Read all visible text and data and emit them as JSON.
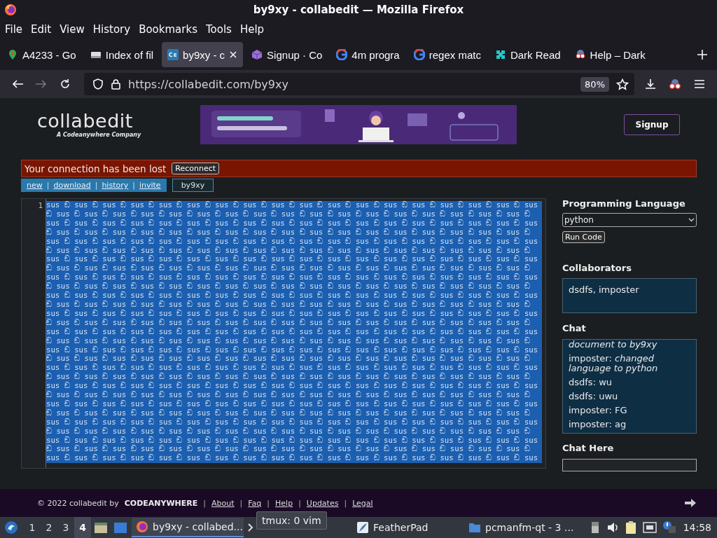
{
  "window": {
    "title": "by9xy - collabedit — Mozilla Firefox"
  },
  "menu": [
    "File",
    "Edit",
    "View",
    "History",
    "Bookmarks",
    "Tools",
    "Help"
  ],
  "tabs": [
    {
      "label": "A4233 - Go",
      "selected": false,
      "kind": "pin"
    },
    {
      "label": "Index of fil",
      "selected": false,
      "kind": "drive"
    },
    {
      "label": "by9xy - c",
      "selected": true,
      "kind": "ce"
    },
    {
      "label": "Signup · Co",
      "selected": false,
      "kind": "cube"
    },
    {
      "label": "4m progra",
      "selected": false,
      "kind": "g"
    },
    {
      "label": "regex matc",
      "selected": false,
      "kind": "g"
    },
    {
      "label": "Dark Read",
      "selected": false,
      "kind": "puzzle"
    },
    {
      "label": "Help – Dark",
      "selected": false,
      "kind": "mask"
    }
  ],
  "navbar": {
    "url": "https://collabedit.com/by9xy",
    "zoom": "80%"
  },
  "header": {
    "logo": "collabedit",
    "tagline": "A Codeanywhere Company",
    "signup": "Signup"
  },
  "alert": {
    "message": "Your connection has been lost",
    "button": "Reconnect"
  },
  "doc_links": [
    {
      "kind": "link",
      "text": "new"
    },
    {
      "kind": "separator",
      "text": "|"
    },
    {
      "kind": "link",
      "text": "download"
    },
    {
      "kind": "separator",
      "text": "|"
    },
    {
      "kind": "link",
      "text": "history"
    },
    {
      "kind": "separator",
      "text": "|"
    },
    {
      "kind": "link",
      "text": "invite"
    }
  ],
  "doc_tab": "by9xy",
  "editor": {
    "line_number": "1",
    "selected": true,
    "rows": [
      "sus ඞ sus ඞ sus ඞ sus ඞ sus ඞ sus ඞ sus ඞ sus ඞ sus ඞ sus ඞ sus ඞ sus ඞ sus ඞ sus ඞ sus ඞ sus ඞ sus ඞ sus",
      "ඞ sus ඞ sus ඞ sus ඞ sus ඞ sus ඞ sus ඞ sus ඞ sus ඞ sus ඞ sus ඞ sus ඞ sus ඞ sus ඞ sus ඞ sus ඞ sus ඞ sus ඞ",
      "sus ඞ sus ඞ sus ඞ sus ඞ sus ඞ sus ඞ sus ඞ sus ඞ sus ඞ sus ඞ sus ඞ sus ඞ sus ඞ sus ඞ sus ඞ sus ඞ sus ඞ sus",
      "ඞ sus ඞ sus ඞ sus ඞ sus ඞ sus ඞ sus ඞ sus ඞ sus ඞ sus ඞ sus ඞ sus ඞ sus ඞ sus ඞ sus ඞ sus ඞ sus ඞ sus ඞ",
      "sus ඞ sus ඞ sus ඞ sus ඞ sus ඞ sus ඞ sus ඞ sus ඞ sus ඞ sus ඞ sus ඞ sus ඞ sus ඞ sus ඞ sus ඞ sus ඞ sus ඞ sus",
      "ඞ sus ඞ sus ඞ sus ඞ sus ඞ sus ඞ sus ඞ sus ඞ sus ඞ sus ඞ sus ඞ sus ඞ sus ඞ sus ඞ sus ඞ sus ඞ sus ඞ sus ඞ",
      "sus ඞ sus ඞ sus ඞ sus ඞ sus ඞ sus ඞ sus ඞ sus ඞ sus ඞ sus ඞ sus ඞ sus ඞ sus ඞ sus ඞ sus ඞ sus ඞ sus ඞ sus",
      "ඞ sus ඞ sus ඞ sus ඞ sus ඞ sus ඞ sus ඞ sus ඞ sus ඞ sus ඞ sus ඞ sus ඞ sus ඞ sus ඞ sus ඞ sus ඞ sus ඞ sus ඞ",
      "sus ඞ sus ඞ sus ඞ sus ඞ sus ඞ sus ඞ sus ඞ sus ඞ sus ඞ sus ඞ sus ඞ sus ඞ sus ඞ sus ඞ sus ඞ sus ඞ sus ඞ sus",
      "ඞ sus ඞ sus ඞ sus ඞ sus ඞ sus ඞ sus ඞ sus ඞ sus ඞ sus ඞ sus ඞ sus ඞ sus ඞ sus ඞ sus ඞ sus ඞ sus ඞ sus ඞ",
      "sus ඞ sus ඞ sus ඞ sus ඞ sus ඞ sus ඞ sus ඞ sus ඞ sus ඞ sus ඞ sus ඞ sus ඞ sus ඞ sus ඞ sus ඞ sus ඞ sus ඞ sus",
      "ඞ sus ඞ sus ඞ sus ඞ sus ඞ sus ඞ sus ඞ sus ඞ sus ඞ sus ඞ sus ඞ sus ඞ sus ඞ sus ඞ sus ඞ sus ඞ sus ඞ sus ඞ",
      "sus ඞ sus ඞ sus ඞ sus ඞ sus ඞ sus ඞ sus ඞ sus ඞ sus ඞ sus ඞ sus ඞ sus ඞ sus ඞ sus ඞ sus ඞ sus ඞ sus ඞ sus",
      "ඞ sus ඞ sus ඞ sus ඞ sus ඞ sus ඞ sus ඞ sus ඞ sus ඞ sus ඞ sus ඞ sus ඞ sus ඞ sus ඞ sus ඞ sus ඞ sus ඞ sus ඞ",
      "sus ඞ sus ඞ sus ඞ sus ඞ sus ඞ sus ඞ sus ඞ sus ඞ sus ඞ sus ඞ sus ඞ sus ඞ sus ඞ sus ඞ sus ඞ sus ඞ sus ඞ sus",
      "ඞ sus ඞ sus ඞ sus ඞ sus ඞ sus ඞ sus ඞ sus ඞ sus ඞ sus ඞ sus ඞ sus ඞ sus ඞ sus ඞ sus ඞ sus ඞ sus ඞ sus ඞ",
      "sus ඞ sus ඞ sus ඞ sus ඞ sus ඞ sus ඞ sus ඞ sus ඞ sus ඞ sus ඞ sus ඞ sus ඞ sus ඞ sus ඞ sus ඞ sus ඞ sus ඞ sus",
      "ඞ sus ඞ sus ඞ sus ඞ sus ඞ sus ඞ sus ඞ sus ඞ sus ඞ sus ඞ sus ඞ sus ඞ sus ඞ sus ඞ sus ඞ sus ඞ sus ඞ sus ඞ",
      "sus ඞ sus ඞ sus ඞ sus ඞ sus ඞ sus ඞ sus ඞ sus ඞ sus ඞ sus ඞ sus ඞ sus ඞ sus ඞ sus ඞ sus ඞ sus ඞ sus ඞ sus",
      "ඞ sus ඞ sus ඞ sus ඞ sus ඞ sus ඞ sus ඞ sus ඞ sus ඞ sus ඞ sus ඞ sus ඞ sus ඞ sus ඞ sus ඞ sus ඞ sus ඞ sus ඞ",
      "sus ඞ sus ඞ sus ඞ sus ඞ sus ඞ sus ඞ sus ඞ sus ඞ sus ඞ sus ඞ sus ඞ sus ඞ sus ඞ sus ඞ sus ඞ sus ඞ sus ඞ sus",
      "ඞ sus ඞ sus ඞ sus ඞ sus ඞ sus ඞ sus ඞ sus ඞ sus ඞ sus ඞ sus ඞ sus ඞ sus ඞ sus ඞ sus ඞ sus ඞ sus ඞ sus ඞ",
      "sus ඞ sus ඞ sus ඞ sus ඞ sus ඞ sus ඞ sus ඞ sus ඞ sus ඞ sus ඞ sus ඞ sus ඞ sus ඞ sus ඞ sus ඞ sus ඞ sus ඞ sus",
      "ඞ sus ඞ sus ඞ sus ඞ sus ඞ sus ඞ sus ඞ sus ඞ sus ඞ sus ඞ sus ඞ sus ඞ sus ඞ sus ඞ sus ඞ sus ඞ sus ඞ sus ඞ",
      "sus ඞ sus ඞ sus ඞ sus ඞ sus ඞ sus ඞ sus ඞ sus ඞ sus ඞ sus ඞ sus ඞ sus ඞ sus ඞ sus ඞ sus ඞ sus ඞ sus ඞ sus",
      "ඞ sus ඞ sus ඞ sus ඞ sus ඞ sus ඞ sus ඞ sus ඞ sus ඞ sus ඞ sus ඞ sus ඞ sus ඞ sus ඞ sus ඞ sus ඞ sus ඞ sus ඞ",
      "sus ඞ sus ඞ sus ඞ sus ඞ sus ඞ sus ඞ sus ඞ sus ඞ sus ඞ sus ඞ sus ඞ sus ඞ sus ඞ sus ඞ sus ඞ sus ඞ sus ඞ sus",
      "ඞ sus ඞ sus ඞ sus ඞ sus ඞ sus ඞ sus ඞ sus ඞ sus ඞ sus ඞ sus ඞ sus ඞ sus ඞ sus ඞ sus ඞ sus ඞ sus ඞ sus ඞ",
      "sus ඞ sus ඞ sus ඞ sus ඞ sus ඞ sus ඞ sus ඞ sus ඞ sus ඞ sus ඞ sus ඞ sus ඞ sus ඞ sus ඞ sus ඞ sus ඞ sus ඞ sus"
    ]
  },
  "sidebar": {
    "language_heading": "Programming Language",
    "language": "python",
    "run_button": "Run Code",
    "collaborators_heading": "Collaborators",
    "collaborators": "dsdfs, imposter",
    "chat_heading": "Chat",
    "chat": [
      {
        "kind": "event",
        "text": "document to by9xy"
      },
      {
        "kind": "message",
        "text": "imposter: *changed language to python*"
      },
      {
        "kind": "message",
        "text": "dsdfs: wu"
      },
      {
        "kind": "message",
        "text": "dsdfs: uwu"
      },
      {
        "kind": "message",
        "text": "imposter: FG"
      },
      {
        "kind": "message",
        "text": "imposter: ag"
      }
    ],
    "chat_input_heading": "Chat Here"
  },
  "footer": {
    "copyright": "© 2022 collabedit by",
    "brand": "CODEANYWHERE",
    "links": [
      {
        "kind": "link",
        "text": "About"
      },
      {
        "kind": "separator",
        "text": "|"
      },
      {
        "kind": "link",
        "text": "Faq"
      },
      {
        "kind": "separator",
        "text": "|"
      },
      {
        "kind": "link",
        "text": "Help"
      },
      {
        "kind": "separator",
        "text": "|"
      },
      {
        "kind": "link",
        "text": "Updates"
      },
      {
        "kind": "separator",
        "text": "|"
      },
      {
        "kind": "link",
        "text": "Legal"
      }
    ],
    "lead_separator": "|"
  },
  "taskbar": {
    "workspaces": [
      {
        "label": "1",
        "selected": false
      },
      {
        "label": "2",
        "selected": false
      },
      {
        "label": "3",
        "selected": false
      },
      {
        "label": "4",
        "selected": true
      }
    ],
    "tasks": [
      {
        "kind": "firefox",
        "label": "by9xy - collabed...",
        "selected": true
      },
      {
        "kind": "terminal",
        "selected": false
      },
      {
        "kind": "feather",
        "label": "FeatherPad",
        "selected": false
      },
      {
        "kind": "folder",
        "label": "pcmanfm-qt - 3 ...",
        "selected": false
      }
    ],
    "tooltip": "tmux: 0 vim",
    "clock": "14:58"
  }
}
